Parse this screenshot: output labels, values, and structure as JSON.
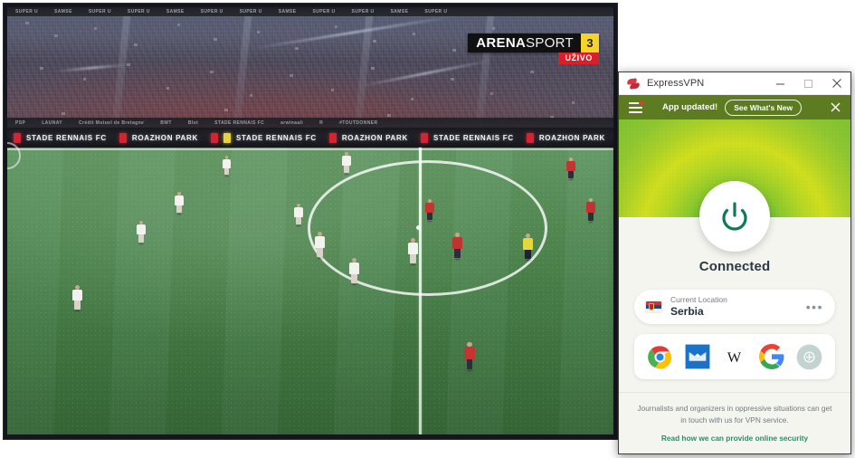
{
  "video": {
    "broadcast_logo": {
      "brand_first": "ARENA",
      "brand_second": "SPORT",
      "channel_number": "3",
      "live_badge": "UŽIVO"
    },
    "led_board_messages": [
      "STADE RENNAIS FC",
      "ROAZHON PARK"
    ],
    "led_upper_ads": [
      "PSP",
      "LAUNAY",
      "Crédit Mutuel de Bretagne",
      "BWT",
      "Blot",
      "STADE RENNAIS FC",
      "arwinaali",
      "R",
      "#TOUTDONNER",
      "SUPER U",
      "SAMSE"
    ],
    "scene": "football match at centre circle"
  },
  "vpn_window": {
    "titlebar": {
      "app_name": "ExpressVPN",
      "minimize_label": "Minimize",
      "maximize_label": "Maximize",
      "close_label": "Close"
    },
    "banner": {
      "message": "App updated!",
      "cta_label": "See What's New",
      "dismiss_label": "Dismiss"
    },
    "status": {
      "text": "Connected",
      "power_label": "Disconnect"
    },
    "location": {
      "label": "Current Location",
      "name": "Serbia",
      "flag": "serbia-flag",
      "options_label": "•••"
    },
    "shortcuts": [
      {
        "name": "Chrome",
        "icon": "chrome-icon"
      },
      {
        "name": "Mail",
        "icon": "mail-icon"
      },
      {
        "name": "Wikipedia",
        "icon": "wikipedia-icon"
      },
      {
        "name": "Google",
        "icon": "google-icon"
      },
      {
        "name": "Add Shortcut",
        "icon": "add-icon"
      }
    ],
    "footer": {
      "text": "Journalists and organizers in oppressive situations can get in touch with us for VPN service.",
      "link": "Read how we can provide online security"
    },
    "colors": {
      "banner_green": "#5d7b20",
      "accent_green": "#2e8b6e",
      "logo_red": "#da3743"
    }
  }
}
